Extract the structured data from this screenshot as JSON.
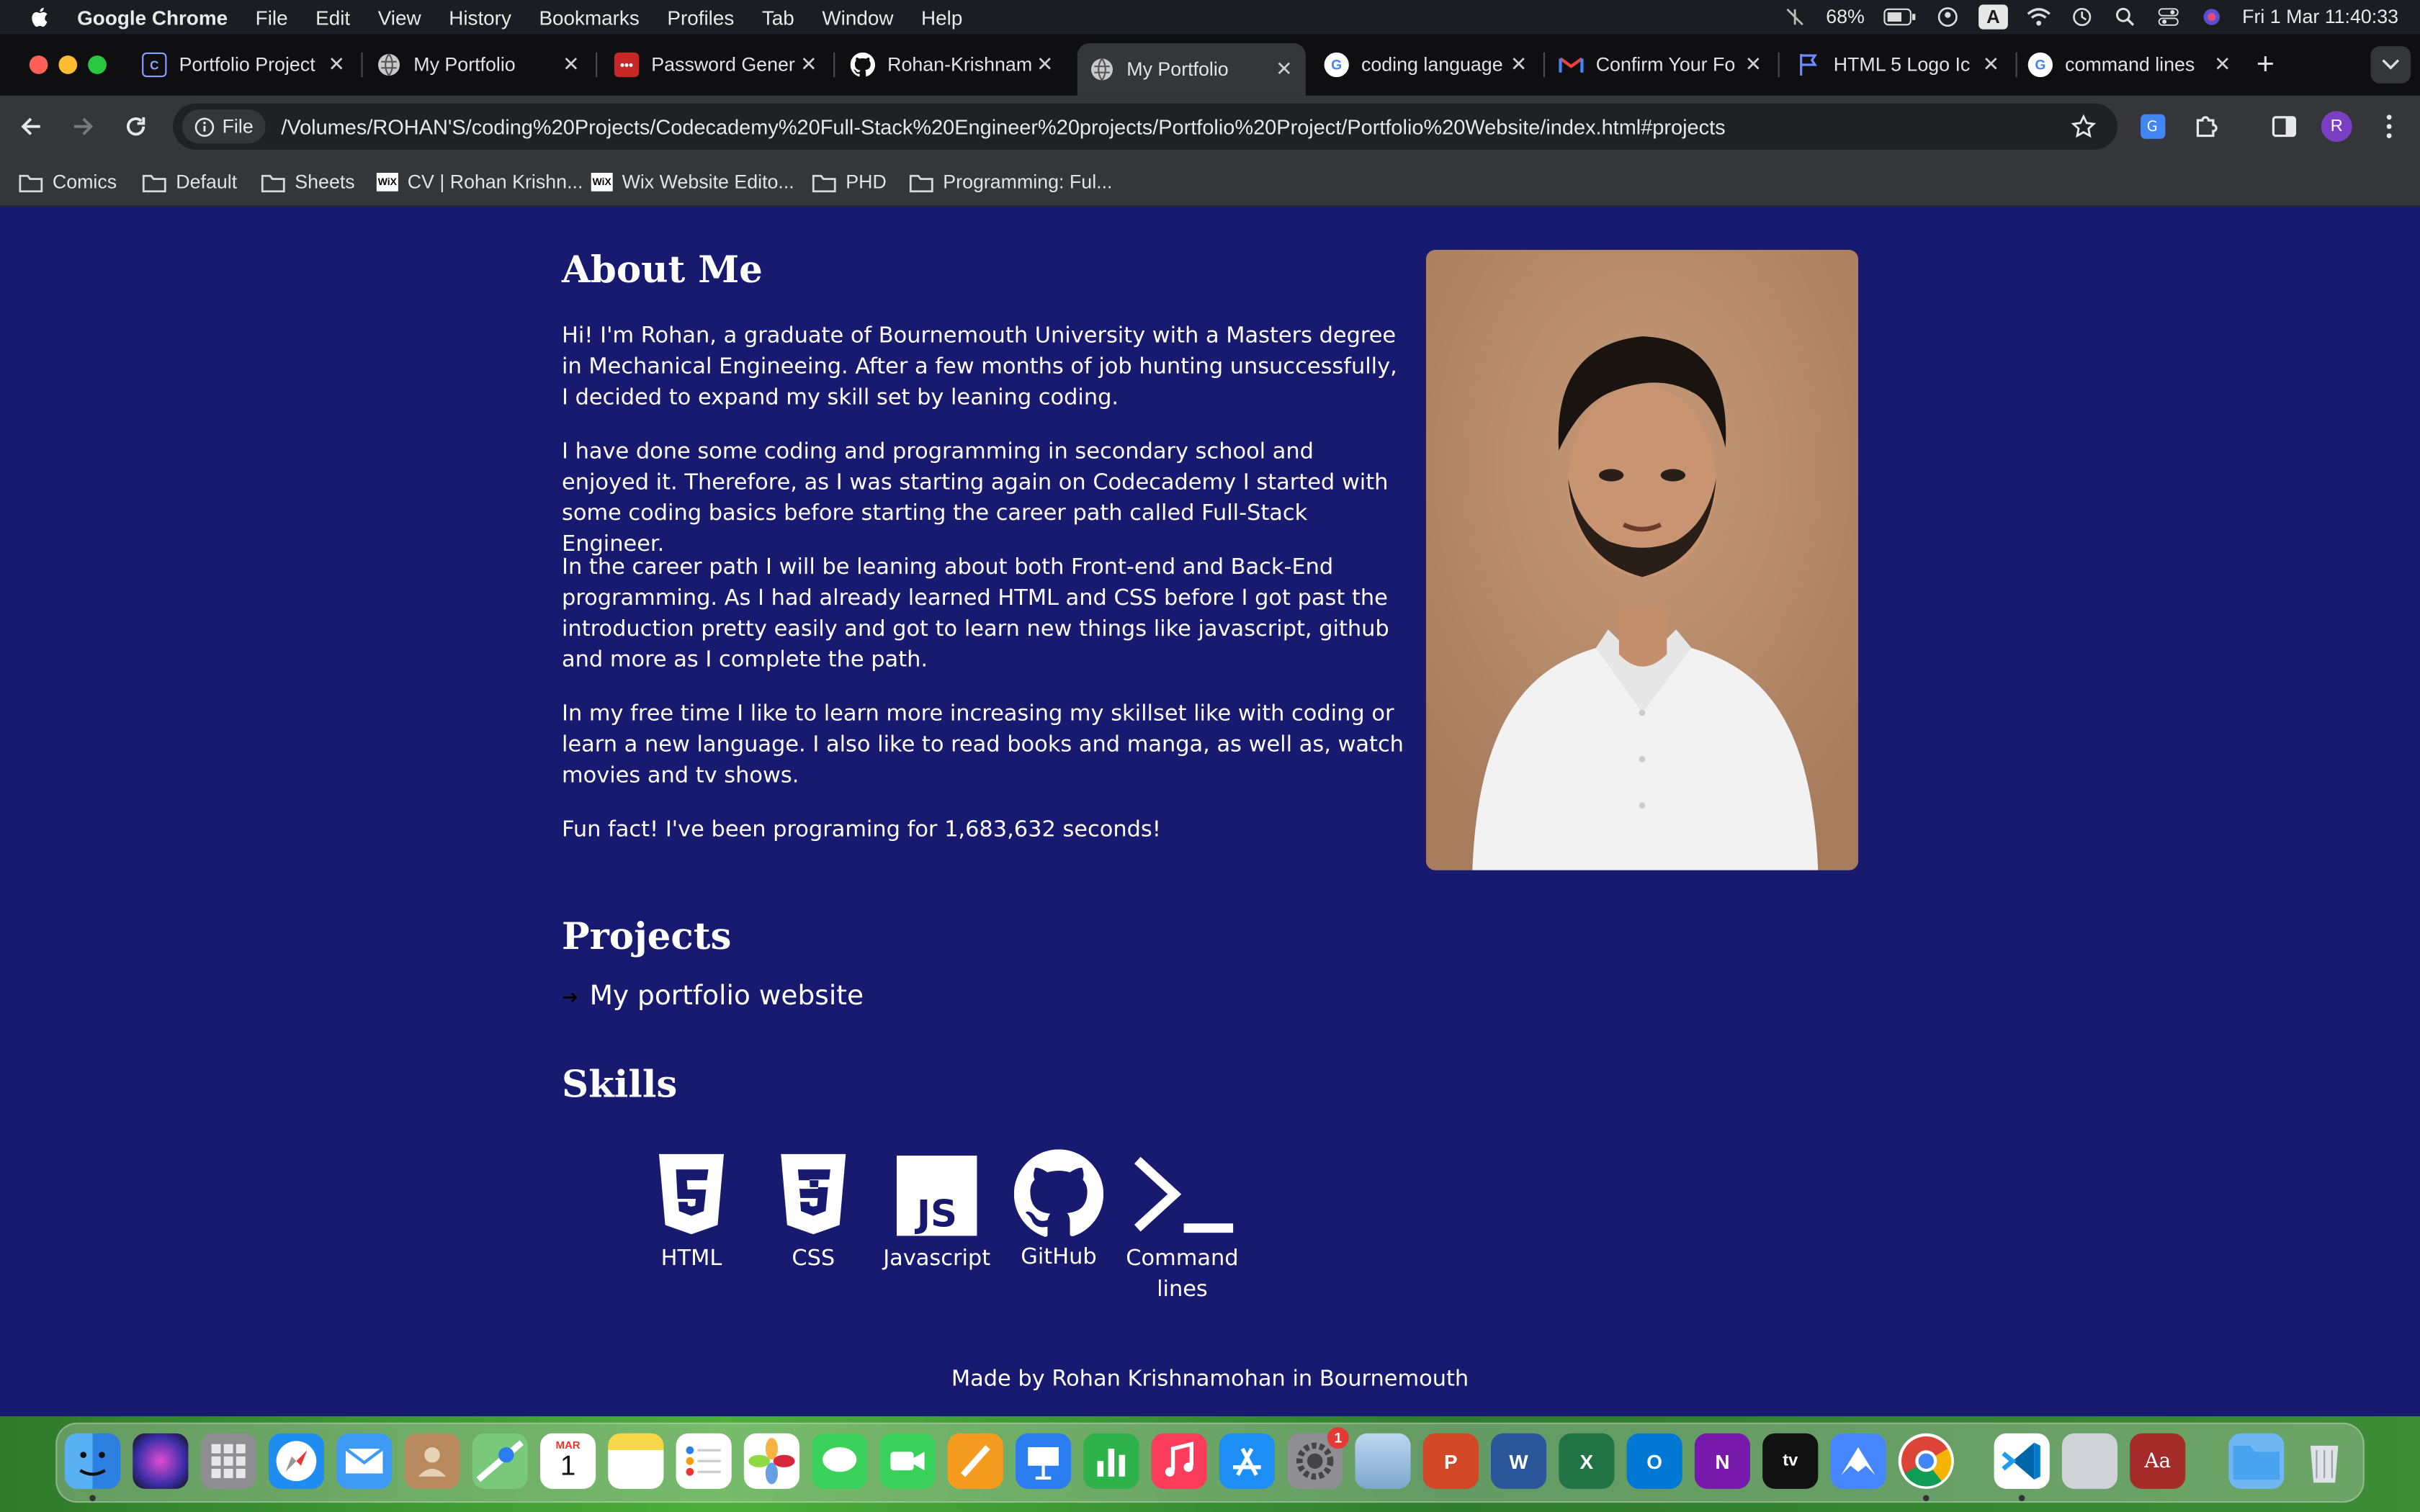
{
  "menubar": {
    "app_name": "Google Chrome",
    "items": [
      "File",
      "Edit",
      "View",
      "History",
      "Bookmarks",
      "Profiles",
      "Tab",
      "Window",
      "Help"
    ],
    "battery": "68%",
    "input_source": "A",
    "datetime": "Fri 1 Mar  11:40:33"
  },
  "tabs": [
    {
      "title": "Portfolio Project",
      "icon": "codecademy-icon",
      "active": false
    },
    {
      "title": "My Portfolio",
      "icon": "globe-icon",
      "active": false
    },
    {
      "title": "Password Gener",
      "icon": "password-gen-icon",
      "active": false
    },
    {
      "title": "Rohan-Krishnam",
      "icon": "github-icon",
      "active": false
    },
    {
      "title": "My Portfolio",
      "icon": "globe-icon",
      "active": true
    },
    {
      "title": "coding language",
      "icon": "google-icon",
      "active": false
    },
    {
      "title": "Confirm Your Fo",
      "icon": "gmail-icon",
      "active": false
    },
    {
      "title": "HTML 5 Logo Ic",
      "icon": "flag-icon",
      "active": false
    },
    {
      "title": "command lines",
      "icon": "google-icon",
      "active": false
    }
  ],
  "toolbar": {
    "chip_label": "File",
    "url": "/Volumes/ROHAN'S/coding%20Projects/Codecademy%20Full-Stack%20Engineer%20projects/Portfolio%20Project/Portfolio%20Website/index.html#projects",
    "profile_initial": "R"
  },
  "bookmarks": [
    {
      "label": "Comics",
      "icon": "folder-icon"
    },
    {
      "label": "Default",
      "icon": "folder-icon"
    },
    {
      "label": "Sheets",
      "icon": "folder-icon"
    },
    {
      "label": "CV | Rohan Krishn...",
      "icon": "wix-icon"
    },
    {
      "label": "Wix Website Edito...",
      "icon": "wix-icon"
    },
    {
      "label": "PHD",
      "icon": "folder-icon"
    },
    {
      "label": "Programming: Ful...",
      "icon": "folder-icon"
    }
  ],
  "page": {
    "about_heading": "About Me",
    "about_paragraphs": [
      "Hi! I'm Rohan, a graduate of Bournemouth University with a Masters degree in Mechanical Engineeing. After a few months of job hunting unsuccessfully, I decided to expand my skill set by leaning coding.",
      "I have done some coding and programming in secondary school and enjoyed it. Therefore, as I was starting again on Codecademy I started with some coding basics before starting the career path called Full-Stack Engineer.",
      "In the career path I will be leaning about both Front-end and Back-End programming. As I had already learned HTML and CSS before I got past the introduction pretty easily and got to learn new things like javascript, github and more as I complete the path.",
      "In my free time I like to learn more increasing my skillset like with coding or learn a new language. I also like to read books and manga, as well as, watch movies and tv shows.",
      "Fun fact! I've been programing for 1,683,632 seconds!"
    ],
    "projects_heading": "Projects",
    "project_link": "My portfolio website",
    "skills_heading": "Skills",
    "skills": [
      {
        "label": "HTML",
        "icon": "html5-icon"
      },
      {
        "label": "CSS",
        "icon": "css3-icon"
      },
      {
        "label": "Javascript",
        "icon": "javascript-icon"
      },
      {
        "label": "GitHub",
        "icon": "github-icon"
      },
      {
        "label": "Command lines",
        "icon": "terminal-icon"
      }
    ],
    "footer": "Made by Rohan Krishnamohan in Bournemouth",
    "background_color": "#171a6e"
  },
  "dock": {
    "calendar_month": "MAR",
    "calendar_day": "1",
    "settings_badge": "1",
    "apps": [
      "finder",
      "siri",
      "launchpad",
      "safari",
      "mail",
      "contacts",
      "maps",
      "calendar",
      "notes",
      "reminders",
      "photos",
      "messages",
      "facetime",
      "pages",
      "keynote",
      "numbers",
      "music",
      "app-store",
      "system-settings",
      "preview",
      "powerpoint",
      "word",
      "excel",
      "outlook",
      "onenote",
      "apple-tv",
      "nordvpn",
      "chrome",
      "vscode",
      "utility",
      "dictionary",
      "downloads",
      "trash"
    ]
  }
}
